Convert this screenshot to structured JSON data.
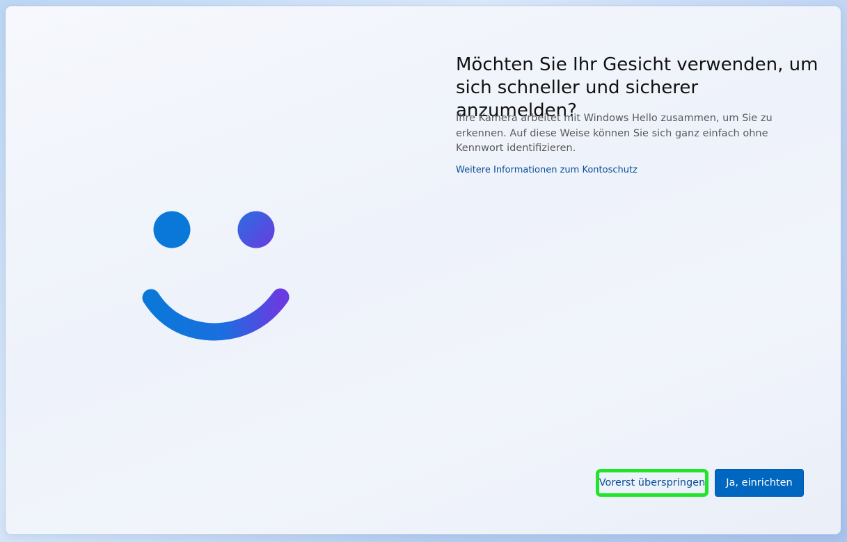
{
  "dialog": {
    "title": "Möchten Sie Ihr Gesicht verwenden, um sich schneller und sicherer anzumelden?",
    "description": "Ihre Kamera arbeitet mit Windows Hello zusammen, um Sie zu erkennen. Auf diese Weise können Sie sich ganz einfach ohne Kennwort identifizieren.",
    "link_text": "Weitere Informationen zum Kontoschutz"
  },
  "buttons": {
    "skip_label": "Vorerst überspringen",
    "setup_label": "Ja, einrichten"
  },
  "illustration": {
    "icon": "windows-hello-smiley-icon",
    "gradient_start": "#0a78d8",
    "gradient_end": "#6a3be0"
  },
  "colors": {
    "accent": "#0067c0",
    "link": "#0b4f96",
    "highlight": "#22e52a"
  }
}
